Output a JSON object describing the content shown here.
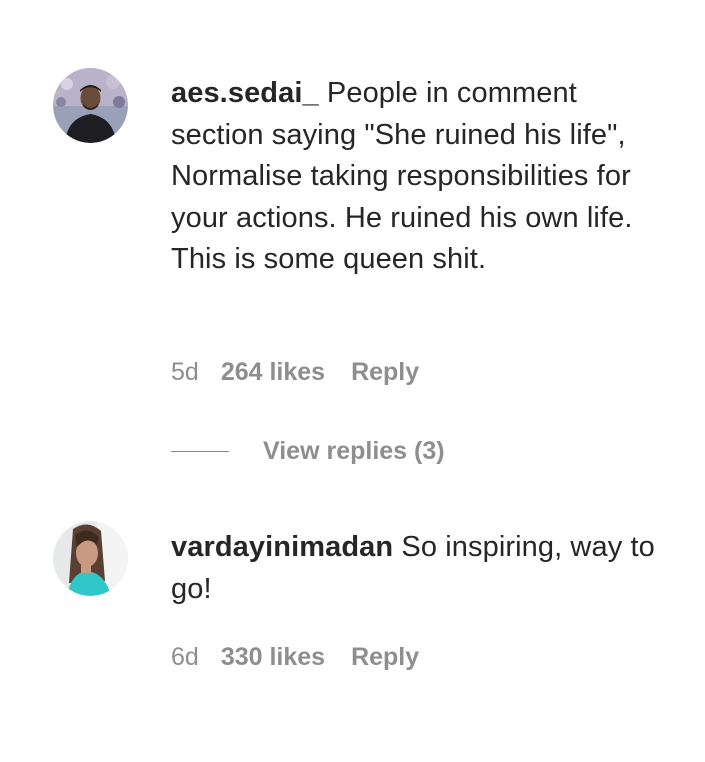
{
  "comments": [
    {
      "username": "aes.sedai_",
      "text": "People in comment section saying \"She ruined his life\", Normalise taking responsibilities for your actions. He ruined his own life. This is some queen shit.",
      "time": "5d",
      "likes": "264 likes",
      "reply_label": "Reply",
      "view_replies": "View replies (3)",
      "avatar_icon": "user-avatar-photo"
    },
    {
      "username": "vardayinimadan",
      "text": "So inspiring, way to go!",
      "time": "6d",
      "likes": "330 likes",
      "reply_label": "Reply",
      "avatar_icon": "user-avatar-photo"
    }
  ],
  "colors": {
    "text": "#262626",
    "secondary": "#8e8e8e",
    "background": "#ffffff"
  }
}
